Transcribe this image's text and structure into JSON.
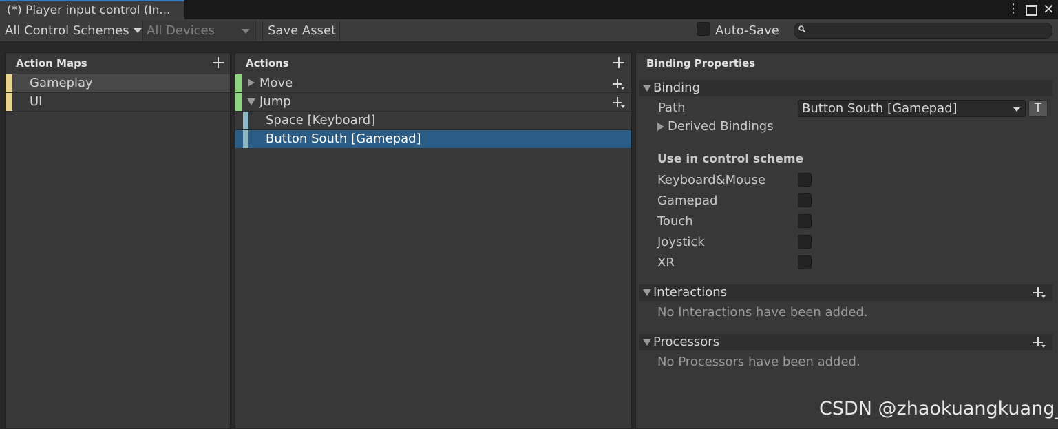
{
  "window": {
    "tab_title": "(*) Player input control (In...",
    "menu_icon": "kebab-menu-icon",
    "maximize_icon": "maximize-icon",
    "close_icon": "close-icon"
  },
  "toolbar": {
    "control_schemes_label": "All Control Schemes",
    "devices_label": "All Devices",
    "save_asset_label": "Save Asset",
    "auto_save_label": "Auto-Save",
    "search_value": ""
  },
  "action_maps": {
    "header": "Action Maps",
    "items": [
      {
        "label": "Gameplay",
        "selected": true
      },
      {
        "label": "UI",
        "selected": false
      }
    ],
    "color": "#e8d58b"
  },
  "actions": {
    "header": "Actions",
    "items": [
      {
        "label": "Move",
        "expanded": false
      },
      {
        "label": "Jump",
        "expanded": true
      }
    ],
    "bindings": [
      {
        "label": "Space [Keyboard]",
        "selected": false
      },
      {
        "label": "Button South [Gamepad]",
        "selected": true
      }
    ],
    "action_color": "#8ed47f",
    "binding_color": "#8fb9c4",
    "selection_color": "#2c5d87"
  },
  "binding_properties": {
    "header": "Binding Properties",
    "binding_section": "Binding",
    "path_label": "Path",
    "path_value": "Button South [Gamepad]",
    "t_button": "T",
    "derived_bindings": "Derived Bindings",
    "scheme_heading": "Use in control scheme",
    "schemes": [
      {
        "label": "Keyboard&Mouse",
        "checked": false
      },
      {
        "label": "Gamepad",
        "checked": false
      },
      {
        "label": "Touch",
        "checked": false
      },
      {
        "label": "Joystick",
        "checked": false
      },
      {
        "label": "XR",
        "checked": false
      }
    ],
    "interactions_section": "Interactions",
    "interactions_empty": "No Interactions have been added.",
    "processors_section": "Processors",
    "processors_empty": "No Processors have been added."
  },
  "watermark": "CSDN @zhaokuangkuang_"
}
